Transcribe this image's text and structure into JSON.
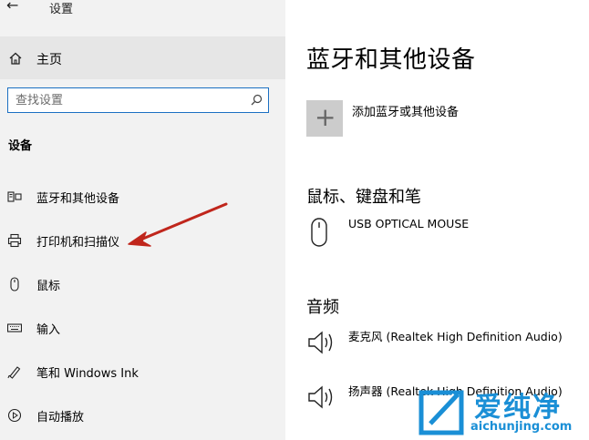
{
  "window": {
    "title": "设置",
    "back_icon": "←"
  },
  "sidebar": {
    "home": "主页",
    "search_placeholder": "查找设置",
    "section": "设备",
    "items": [
      {
        "label": "蓝牙和其他设备",
        "icon": "bluetooth-devices-icon"
      },
      {
        "label": "打印机和扫描仪",
        "icon": "printer-icon"
      },
      {
        "label": "鼠标",
        "icon": "mouse-icon"
      },
      {
        "label": "输入",
        "icon": "keyboard-icon"
      },
      {
        "label": "笔和 Windows Ink",
        "icon": "pen-icon"
      },
      {
        "label": "自动播放",
        "icon": "autoplay-icon"
      }
    ]
  },
  "main": {
    "title": "蓝牙和其他设备",
    "add_device": "添加蓝牙或其他设备",
    "mouse_section": "鼠标、键盘和笔",
    "mouse_device": "USB OPTICAL MOUSE",
    "audio_section": "音频",
    "audio_devices": [
      "麦克风 (Realtek High Definition Audio)",
      "扬声器 (Realtek High Definition Audio)"
    ]
  },
  "watermark": {
    "brand": "爱纯净",
    "url": "aichunjing.com"
  },
  "colors": {
    "accent": "#1b6fc2",
    "sidebar_bg": "#f2f2f2",
    "arrow": "#c0261c",
    "watermark": "#1a8fd6"
  }
}
